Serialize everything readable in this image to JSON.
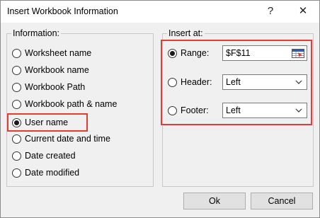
{
  "window": {
    "title": "Insert Workbook Information",
    "help": "?",
    "close": "✕"
  },
  "information": {
    "label": "Information:",
    "options": [
      {
        "label": "Worksheet name",
        "checked": false
      },
      {
        "label": "Workbook name",
        "checked": false
      },
      {
        "label": "Workbook Path",
        "checked": false
      },
      {
        "label": "Workbook path & name",
        "checked": false
      },
      {
        "label": "User name",
        "checked": true
      },
      {
        "label": "Current date and time",
        "checked": false
      },
      {
        "label": "Date created",
        "checked": false
      },
      {
        "label": "Date modified",
        "checked": false
      }
    ]
  },
  "insert_at": {
    "label": "Insert at:",
    "range": {
      "label": "Range:",
      "value": "$F$11",
      "checked": true
    },
    "header": {
      "label": "Header:",
      "value": "Left",
      "checked": false
    },
    "footer": {
      "label": "Footer:",
      "value": "Left",
      "checked": false
    }
  },
  "buttons": {
    "ok": "Ok",
    "cancel": "Cancel"
  },
  "colors": {
    "highlight": "#e03c3c",
    "dialog_bg": "#f0f0f0"
  },
  "icons": [
    "range-select-icon",
    "chevron-down-icon",
    "close-icon",
    "help-icon"
  ]
}
